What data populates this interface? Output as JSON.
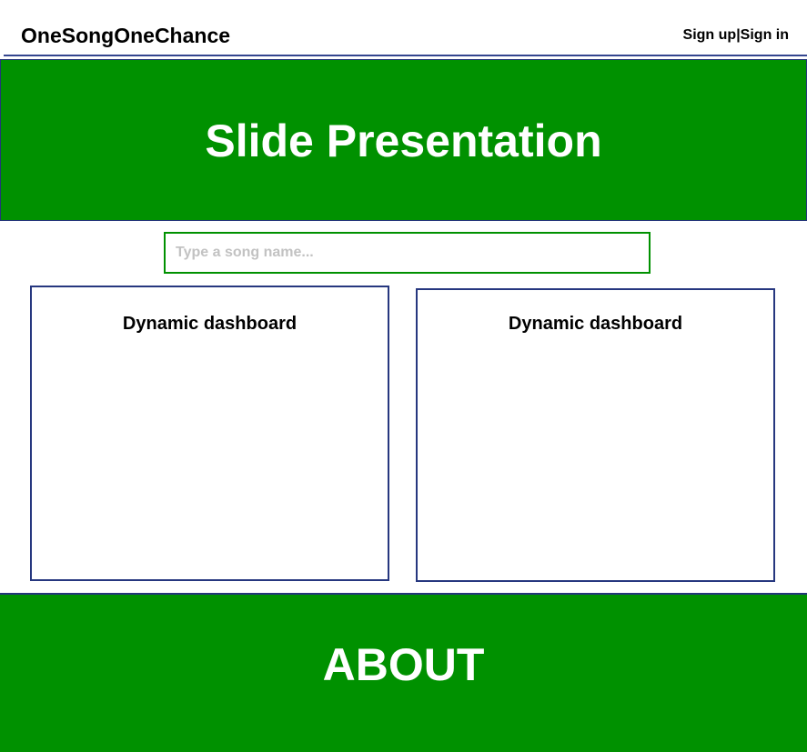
{
  "header": {
    "brand": "OneSongOneChance",
    "signup_label": "Sign up",
    "separator": "|",
    "signin_label": "Sign in"
  },
  "hero": {
    "title": "Slide Presentation"
  },
  "search": {
    "value": "",
    "placeholder": "Type a song name..."
  },
  "dashboards": [
    {
      "title": "Dynamic dashboard"
    },
    {
      "title": "Dynamic dashboard"
    }
  ],
  "about": {
    "title": "ABOUT"
  },
  "colors": {
    "accent_green": "#009100",
    "border_navy": "#26377f",
    "placeholder_gray": "#c2c2c2"
  }
}
